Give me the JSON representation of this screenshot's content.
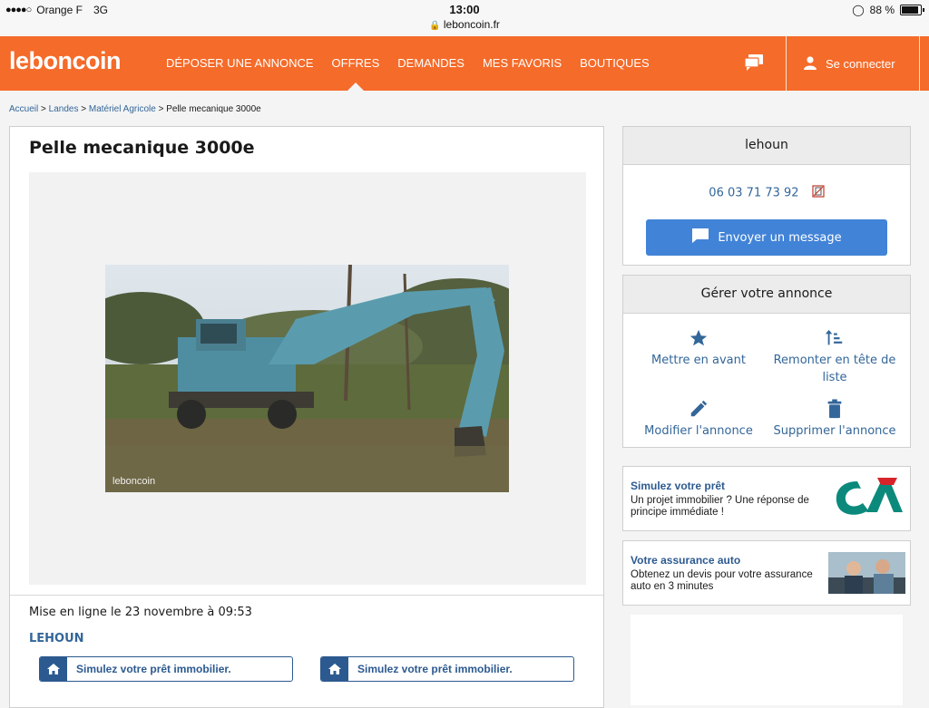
{
  "status_bar": {
    "carrier": "Orange F",
    "network": "3G",
    "time": "13:00",
    "url": "leboncoin.fr",
    "battery": "88 %",
    "battery_level": 0.88
  },
  "header": {
    "logo": "leboncoin",
    "nav": [
      {
        "label": "DÉPOSER UNE ANNONCE"
      },
      {
        "label": "OFFRES"
      },
      {
        "label": "DEMANDES"
      },
      {
        "label": "MES FAVORIS"
      },
      {
        "label": "BOUTIQUES"
      }
    ],
    "active_nav": "OFFRES",
    "login_label": "Se connecter"
  },
  "breadcrumb": [
    {
      "label": "Accueil"
    },
    {
      "label": "Landes"
    },
    {
      "label": "Matériel Agricole"
    },
    {
      "label": "Pelle mecanique 3000e"
    }
  ],
  "listing": {
    "title": "Pelle mecanique 3000e",
    "photo_watermark": "leboncoin",
    "published": "Mise en ligne le 23 novembre à 09:53",
    "seller": "LEHOUN",
    "loan_buttons": [
      {
        "label": "Simulez votre prêt immobilier."
      },
      {
        "label": "Simulez votre prêt immobilier."
      }
    ]
  },
  "contact": {
    "username": "lehoun",
    "phone": "06 03 71 73 92",
    "send_message": "Envoyer un message"
  },
  "manage": {
    "title": "Gérer votre annonce",
    "actions": [
      {
        "label": "Mettre en avant",
        "icon": "star-icon"
      },
      {
        "label": "Remonter en tête de liste",
        "icon": "sort-up-icon"
      },
      {
        "label": "Modifier l'annonce",
        "icon": "pencil-icon"
      },
      {
        "label": "Supprimer l'annonce",
        "icon": "trash-icon"
      }
    ]
  },
  "ads": [
    {
      "title": "Simulez votre prêt",
      "text": "Un projet immobilier ? Une réponse de principe immédiate !"
    },
    {
      "title": "Votre assurance auto",
      "text": "Obtenez un devis pour votre assurance auto en 3 minutes"
    }
  ],
  "colors": {
    "brand_orange": "#f56b2a",
    "link_blue": "#336699",
    "button_blue": "#4183d7"
  }
}
